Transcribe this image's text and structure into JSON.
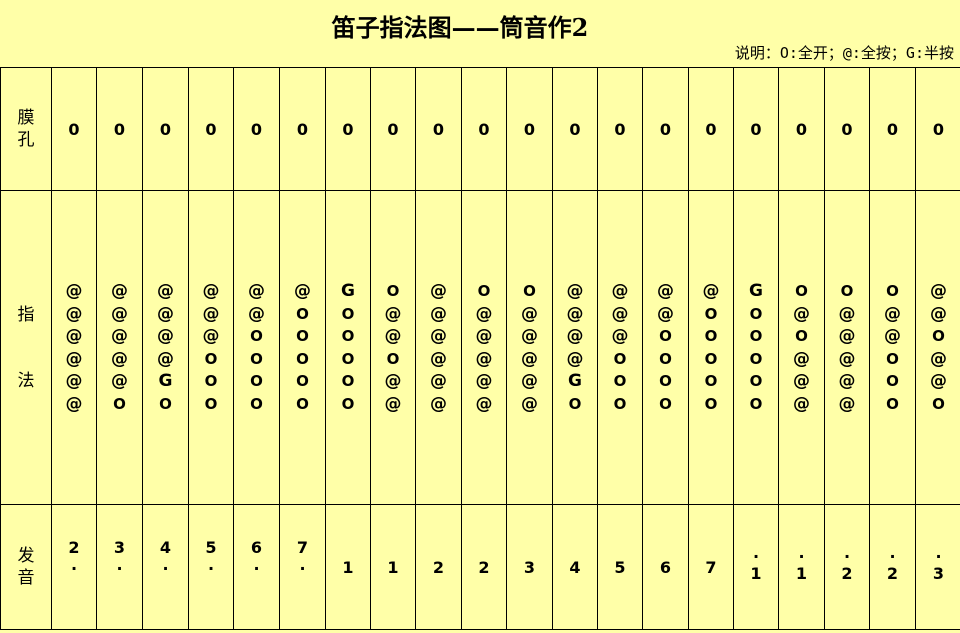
{
  "title": "笛子指法图——筒音作2",
  "legend": "说明：O:全开；@:全按；G:半按",
  "row_labels": {
    "hole": [
      "膜",
      "孔"
    ],
    "fingering": [
      "指",
      "法"
    ],
    "pitch": [
      "发",
      "音"
    ]
  },
  "columns": [
    {
      "hole": "0",
      "fingering": [
        "@",
        "@",
        "@",
        "@",
        "@",
        "@"
      ],
      "pitch": {
        "num": "2",
        "dot": "below"
      }
    },
    {
      "hole": "0",
      "fingering": [
        "@",
        "@",
        "@",
        "@",
        "@",
        "O"
      ],
      "pitch": {
        "num": "3",
        "dot": "below"
      }
    },
    {
      "hole": "0",
      "fingering": [
        "@",
        "@",
        "@",
        "@",
        "G",
        "O"
      ],
      "pitch": {
        "num": "4",
        "dot": "below"
      }
    },
    {
      "hole": "0",
      "fingering": [
        "@",
        "@",
        "@",
        "O",
        "O",
        "O"
      ],
      "pitch": {
        "num": "5",
        "dot": "below"
      }
    },
    {
      "hole": "0",
      "fingering": [
        "@",
        "@",
        "O",
        "O",
        "O",
        "O"
      ],
      "pitch": {
        "num": "6",
        "dot": "below"
      }
    },
    {
      "hole": "0",
      "fingering": [
        "@",
        "O",
        "O",
        "O",
        "O",
        "O"
      ],
      "pitch": {
        "num": "7",
        "dot": "below"
      }
    },
    {
      "hole": "0",
      "fingering": [
        "G",
        "O",
        "O",
        "O",
        "O",
        "O"
      ],
      "pitch": {
        "num": "1",
        "dot": "none"
      }
    },
    {
      "hole": "0",
      "fingering": [
        "O",
        "@",
        "@",
        "O",
        "@",
        "@"
      ],
      "pitch": {
        "num": "1",
        "dot": "none"
      }
    },
    {
      "hole": "0",
      "fingering": [
        "@",
        "@",
        "@",
        "@",
        "@",
        "@"
      ],
      "pitch": {
        "num": "2",
        "dot": "none"
      }
    },
    {
      "hole": "0",
      "fingering": [
        "O",
        "@",
        "@",
        "@",
        "@",
        "@"
      ],
      "pitch": {
        "num": "2",
        "dot": "none"
      }
    },
    {
      "hole": "0",
      "fingering": [
        "O",
        "@",
        "@",
        "@",
        "@",
        "@"
      ],
      "pitch": {
        "num": "3",
        "dot": "none"
      }
    },
    {
      "hole": "0",
      "fingering": [
        "@",
        "@",
        "@",
        "@",
        "G",
        "O"
      ],
      "pitch": {
        "num": "4",
        "dot": "none"
      }
    },
    {
      "hole": "0",
      "fingering": [
        "@",
        "@",
        "@",
        "O",
        "O",
        "O"
      ],
      "pitch": {
        "num": "5",
        "dot": "none"
      }
    },
    {
      "hole": "0",
      "fingering": [
        "@",
        "@",
        "O",
        "O",
        "O",
        "O"
      ],
      "pitch": {
        "num": "6",
        "dot": "none"
      }
    },
    {
      "hole": "0",
      "fingering": [
        "@",
        "O",
        "O",
        "O",
        "O",
        "O"
      ],
      "pitch": {
        "num": "7",
        "dot": "none"
      }
    },
    {
      "hole": "0",
      "fingering": [
        "G",
        "O",
        "O",
        "O",
        "O",
        "O"
      ],
      "pitch": {
        "num": "1",
        "dot": "above"
      }
    },
    {
      "hole": "0",
      "fingering": [
        "O",
        "@",
        "O",
        "@",
        "@",
        "@"
      ],
      "pitch": {
        "num": "1",
        "dot": "above"
      }
    },
    {
      "hole": "0",
      "fingering": [
        "O",
        "@",
        "@",
        "@",
        "@",
        "@"
      ],
      "pitch": {
        "num": "2",
        "dot": "above"
      }
    },
    {
      "hole": "0",
      "fingering": [
        "O",
        "@",
        "@",
        "O",
        "O",
        "O"
      ],
      "pitch": {
        "num": "2",
        "dot": "above"
      }
    },
    {
      "hole": "0",
      "fingering": [
        "@",
        "@",
        "O",
        "@",
        "@",
        "O"
      ],
      "pitch": {
        "num": "3",
        "dot": "above"
      }
    }
  ]
}
